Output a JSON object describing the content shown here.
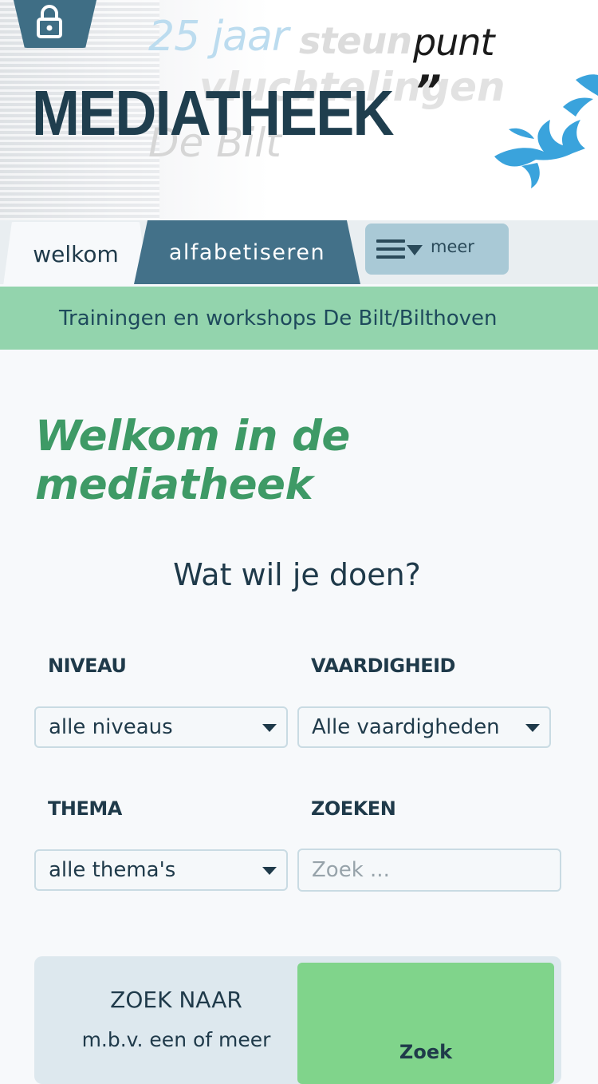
{
  "header": {
    "logo_text": "MEDIATHEEK",
    "tagline_25": "25 jaar",
    "tagline_steun": "steun",
    "tagline_punt": "punt",
    "tagline_vluchtelingen": "vluchtelingen",
    "tagline_quote": "”",
    "tagline_debilt": "De Bilt",
    "lock_icon": "lock-icon"
  },
  "nav": {
    "tabs": [
      {
        "label": "welkom",
        "active": true
      },
      {
        "label": "alfabetiseren",
        "active": false
      }
    ],
    "more_label": "meer",
    "more_icon": "hamburger-icon"
  },
  "banner": {
    "text": "Trainingen en workshops De Bilt/Bilthoven"
  },
  "main": {
    "title": "Welkom in de mediatheek",
    "question": "Wat wil je doen?",
    "filters": {
      "niveau": {
        "label": "NIVEAU",
        "value": "alle niveaus"
      },
      "vaardigheid": {
        "label": "VAARDIGHEID",
        "value": "Alle vaardigheden"
      },
      "thema": {
        "label": "THEMA",
        "value": "alle thema's"
      },
      "zoeken": {
        "label": "ZOEKEN",
        "placeholder": "Zoek ..."
      }
    },
    "search_panel": {
      "title": "ZOEK NAAR",
      "subtitle": "m.b.v. een of meer",
      "button_label": "Zoek"
    }
  },
  "colors": {
    "accent_dark": "#437189",
    "banner_green": "#93d4ad",
    "title_green": "#3e9a66",
    "button_green": "#80d48b"
  }
}
